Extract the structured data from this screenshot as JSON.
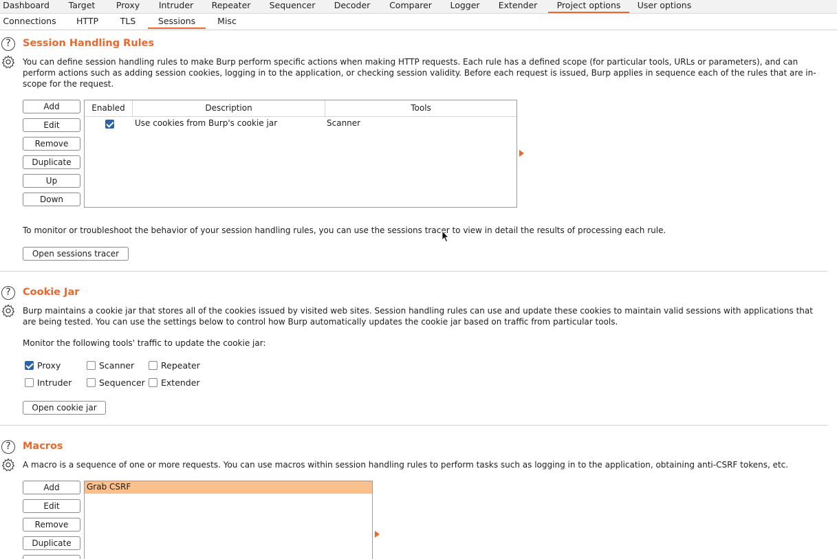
{
  "top_tabs": [
    "Dashboard",
    "Target",
    "Proxy",
    "Intruder",
    "Repeater",
    "Sequencer",
    "Decoder",
    "Comparer",
    "Logger",
    "Extender",
    "Project options",
    "User options"
  ],
  "active_top_tab": "Project options",
  "sub_tabs": [
    "Connections",
    "HTTP",
    "TLS",
    "Sessions",
    "Misc"
  ],
  "active_sub_tab": "Sessions",
  "session_rules": {
    "title": "Session Handling Rules",
    "description": "You can define session handling rules to make Burp perform specific actions when making HTTP requests. Each rule has a defined scope (for particular tools, URLs or parameters), and can perform actions such as adding session cookies, logging in to the application, or checking session validity. Before each request is issued, Burp applies in sequence each of the rules that are in-scope for the request.",
    "buttons": [
      "Add",
      "Edit",
      "Remove",
      "Duplicate",
      "Up",
      "Down"
    ],
    "columns": [
      "Enabled",
      "Description",
      "Tools"
    ],
    "rows": [
      {
        "enabled": true,
        "description": "Use cookies from Burp's cookie jar",
        "tools": "Scanner"
      }
    ],
    "tracer_text": "To monitor or troubleshoot the behavior of your session handling rules, you can use the sessions tracer to view in detail the results of processing each rule.",
    "tracer_button": "Open sessions tracer"
  },
  "cookie_jar": {
    "title": "Cookie Jar",
    "description": "Burp maintains a cookie jar that stores all of the cookies issued by visited web sites. Session handling rules can use and update these cookies to maintain valid sessions with applications that are being tested. You can use the settings below to control how Burp automatically updates the cookie jar based on traffic from particular tools.",
    "monitor_label": "Monitor the following tools' traffic to update the cookie jar:",
    "tools": [
      {
        "label": "Proxy",
        "checked": true
      },
      {
        "label": "Scanner",
        "checked": false
      },
      {
        "label": "Repeater",
        "checked": false
      },
      {
        "label": "Intruder",
        "checked": false
      },
      {
        "label": "Sequencer",
        "checked": false
      },
      {
        "label": "Extender",
        "checked": false
      }
    ],
    "open_button": "Open cookie jar"
  },
  "macros": {
    "title": "Macros",
    "description": "A macro is a sequence of one or more requests. You can use macros within session handling rules to perform tasks such as logging in to the application, obtaining anti-CSRF tokens, etc.",
    "buttons": [
      "Add",
      "Edit",
      "Remove",
      "Duplicate"
    ],
    "items": [
      "Grab CSRF"
    ]
  },
  "colors": {
    "accent": "#e8682e",
    "selected_row": "#fbc08f",
    "checkbox": "#2f63a8"
  },
  "icons": [
    "help-icon",
    "gear-icon",
    "checkbox-icon",
    "expand-arrow-icon",
    "mouse-cursor-icon"
  ]
}
